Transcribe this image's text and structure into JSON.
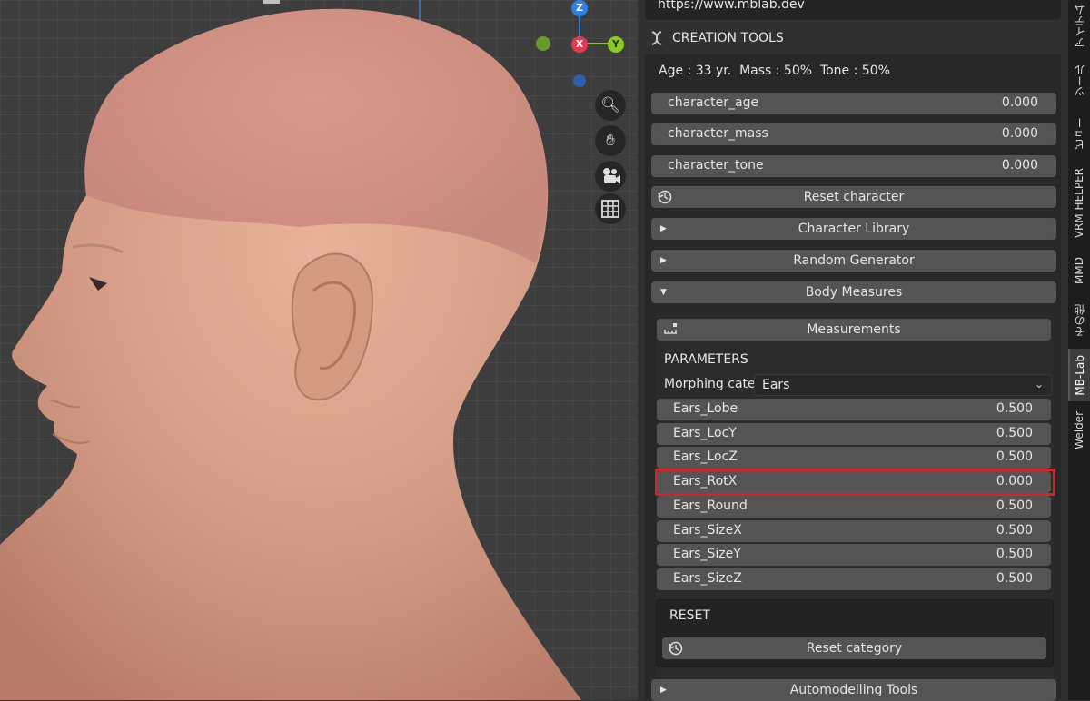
{
  "viewport": {
    "gizmo": {
      "z": "Z",
      "x": "X",
      "y": "Y"
    },
    "nav_icons": [
      "zoom-icon",
      "hand-pan-icon",
      "camera-icon",
      "grid-icon"
    ]
  },
  "panel": {
    "url": "https://www.mblab.dev",
    "creation_tools": "CREATION TOOLS",
    "summary": "Age : 33 yr.  Mass : 50%  Tone : 50%",
    "character_fields": [
      {
        "label": "character_age",
        "value": "0.000"
      },
      {
        "label": "character_mass",
        "value": "0.000"
      },
      {
        "label": "character_tone",
        "value": "0.000"
      }
    ],
    "reset_character": "Reset character",
    "character_library": "Character Library",
    "random_generator": "Random Generator",
    "body_measures": "Body Measures",
    "measurements": "Measurements",
    "parameters": "PARAMETERS",
    "morphing_label": "Morphing cate..",
    "morphing_value": "Ears",
    "params": [
      {
        "label": "Ears_Lobe",
        "value": "0.500"
      },
      {
        "label": "Ears_LocY",
        "value": "0.500"
      },
      {
        "label": "Ears_LocZ",
        "value": "0.500"
      },
      {
        "label": "Ears_RotX",
        "value": "0.000"
      },
      {
        "label": "Ears_Round",
        "value": "0.500"
      },
      {
        "label": "Ears_SizeX",
        "value": "0.500"
      },
      {
        "label": "Ears_SizeY",
        "value": "0.500"
      },
      {
        "label": "Ears_SizeZ",
        "value": "0.500"
      }
    ],
    "reset_heading": "RESET",
    "reset_category": "Reset category",
    "automodelling": "Automodelling Tools"
  },
  "tabs": [
    {
      "label": "アイテム"
    },
    {
      "label": "ツール"
    },
    {
      "label": "ビュー"
    },
    {
      "label": "VRM HELPER"
    },
    {
      "label": "MMD"
    },
    {
      "label": "その他"
    },
    {
      "label": "MB-Lab",
      "active": true
    },
    {
      "label": "Welder"
    }
  ],
  "colors": {
    "highlight": "#d4222a",
    "axis_x": "#e8364f",
    "axis_y": "#8ac926",
    "axis_z": "#2f7fe8"
  }
}
